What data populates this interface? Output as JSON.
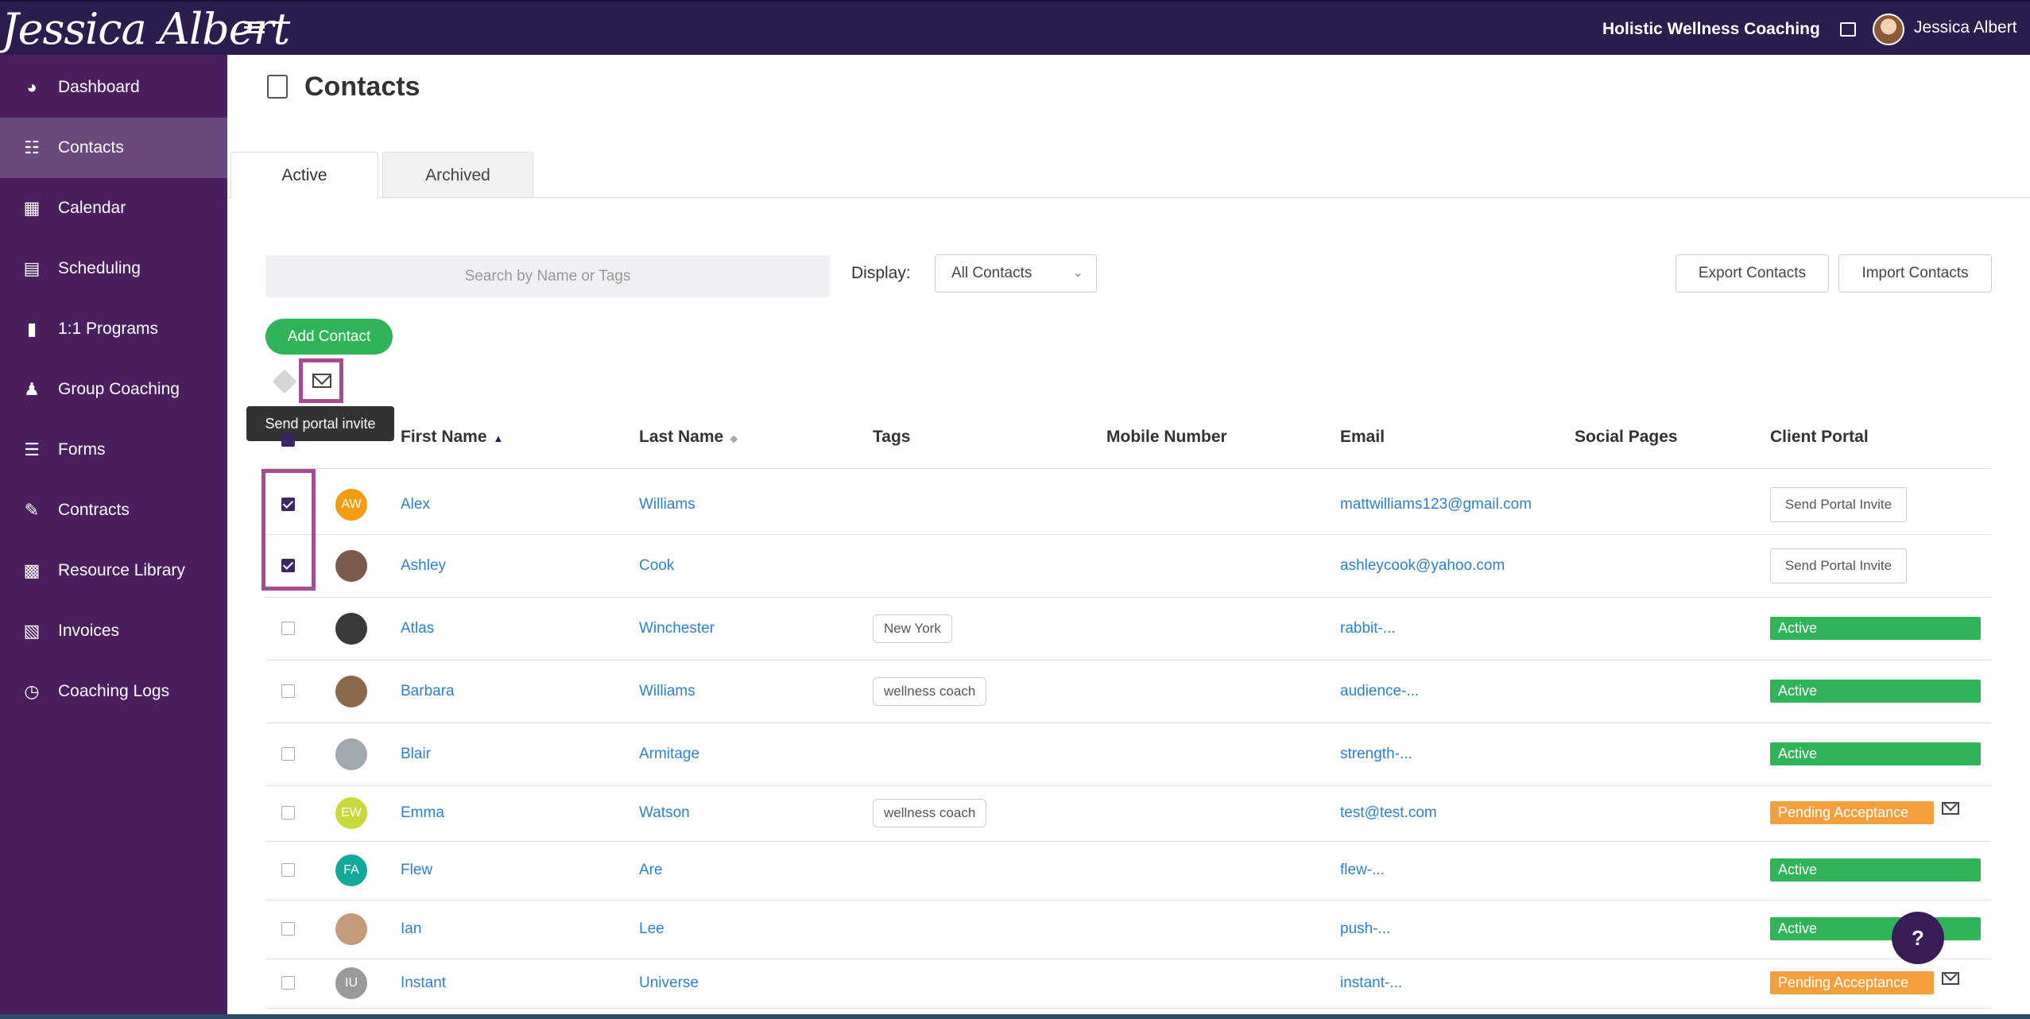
{
  "app": {
    "logo_text": "Jessica Albert",
    "business_name": "Holistic Wellness Coaching",
    "user_name": "Jessica Albert"
  },
  "sidebar": {
    "items": [
      {
        "label": "Dashboard",
        "icon": "dashboard-icon",
        "active": false
      },
      {
        "label": "Contacts",
        "icon": "contacts-icon",
        "active": true
      },
      {
        "label": "Calendar",
        "icon": "calendar-icon",
        "active": false
      },
      {
        "label": "Scheduling",
        "icon": "scheduling-icon",
        "active": false
      },
      {
        "label": "1:1 Programs",
        "icon": "book-icon",
        "active": false
      },
      {
        "label": "Group Coaching",
        "icon": "group-icon",
        "active": false
      },
      {
        "label": "Forms",
        "icon": "checklist-icon",
        "active": false
      },
      {
        "label": "Contracts",
        "icon": "contract-icon",
        "active": false
      },
      {
        "label": "Resource Library",
        "icon": "library-icon",
        "active": false
      },
      {
        "label": "Invoices",
        "icon": "invoice-icon",
        "active": false
      },
      {
        "label": "Coaching Logs",
        "icon": "clock-icon",
        "active": false
      }
    ]
  },
  "page": {
    "title": "Contacts",
    "tabs": [
      {
        "label": "Active",
        "active": true
      },
      {
        "label": "Archived",
        "active": false
      }
    ]
  },
  "toolbar": {
    "search_placeholder": "Search by Name or Tags",
    "display_label": "Display:",
    "display_value": "All Contacts",
    "export_label": "Export Contacts",
    "import_label": "Import Contacts",
    "add_label": "Add Contact",
    "tooltip": "Send portal invite"
  },
  "table": {
    "headers": {
      "first_name": "First Name",
      "last_name": "Last Name",
      "tags": "Tags",
      "mobile": "Mobile Number",
      "email": "Email",
      "social": "Social Pages",
      "portal": "Client Portal"
    },
    "rows": [
      {
        "checked": true,
        "initials": "AW",
        "avatar_color": "#f39c12",
        "first": "Alex",
        "last": "Williams",
        "tag": "",
        "email": "mattwilliams123@gmail.com",
        "portal": "Send Portal Invite",
        "portal_type": "button"
      },
      {
        "checked": true,
        "initials": "",
        "avatar_color": "#7a5a4a",
        "first": "Ashley",
        "last": "Cook",
        "tag": "",
        "email": "ashleycook@yahoo.com",
        "portal": "Send Portal Invite",
        "portal_type": "button"
      },
      {
        "checked": false,
        "initials": "",
        "avatar_color": "#3a3a3a",
        "first": "Atlas",
        "last": "Winchester",
        "tag": "New York",
        "email": "rabbit-...",
        "portal": "Active",
        "portal_type": "active"
      },
      {
        "checked": false,
        "initials": "",
        "avatar_color": "#8a6a4a",
        "first": "Barbara",
        "last": "Williams",
        "tag": "wellness coach",
        "email": "audience-...",
        "portal": "Active",
        "portal_type": "active"
      },
      {
        "checked": false,
        "initials": "",
        "avatar_color": "#a0a8b0",
        "first": "Blair",
        "last": "Armitage",
        "tag": "",
        "email": "strength-...",
        "portal": "Active",
        "portal_type": "active"
      },
      {
        "checked": false,
        "initials": "EW",
        "avatar_color": "#c9d83a",
        "first": "Emma",
        "last": "Watson",
        "tag": "wellness coach",
        "email": "test@test.com",
        "portal": "Pending Acceptance",
        "portal_type": "pending"
      },
      {
        "checked": false,
        "initials": "FA",
        "avatar_color": "#12a89a",
        "first": "Flew",
        "last": "Are",
        "tag": "",
        "email": "flew-...",
        "portal": "Active",
        "portal_type": "active"
      },
      {
        "checked": false,
        "initials": "",
        "avatar_color": "#c49a7a",
        "first": "Ian",
        "last": "Lee",
        "tag": "",
        "email": "push-...",
        "portal": "Active",
        "portal_type": "active"
      },
      {
        "checked": false,
        "initials": "IU",
        "avatar_color": "#9a9a9a",
        "first": "Instant",
        "last": "Universe",
        "tag": "",
        "email": "instant-...",
        "portal": "Pending Acceptance",
        "portal_type": "pending"
      }
    ]
  },
  "help_label": "?"
}
